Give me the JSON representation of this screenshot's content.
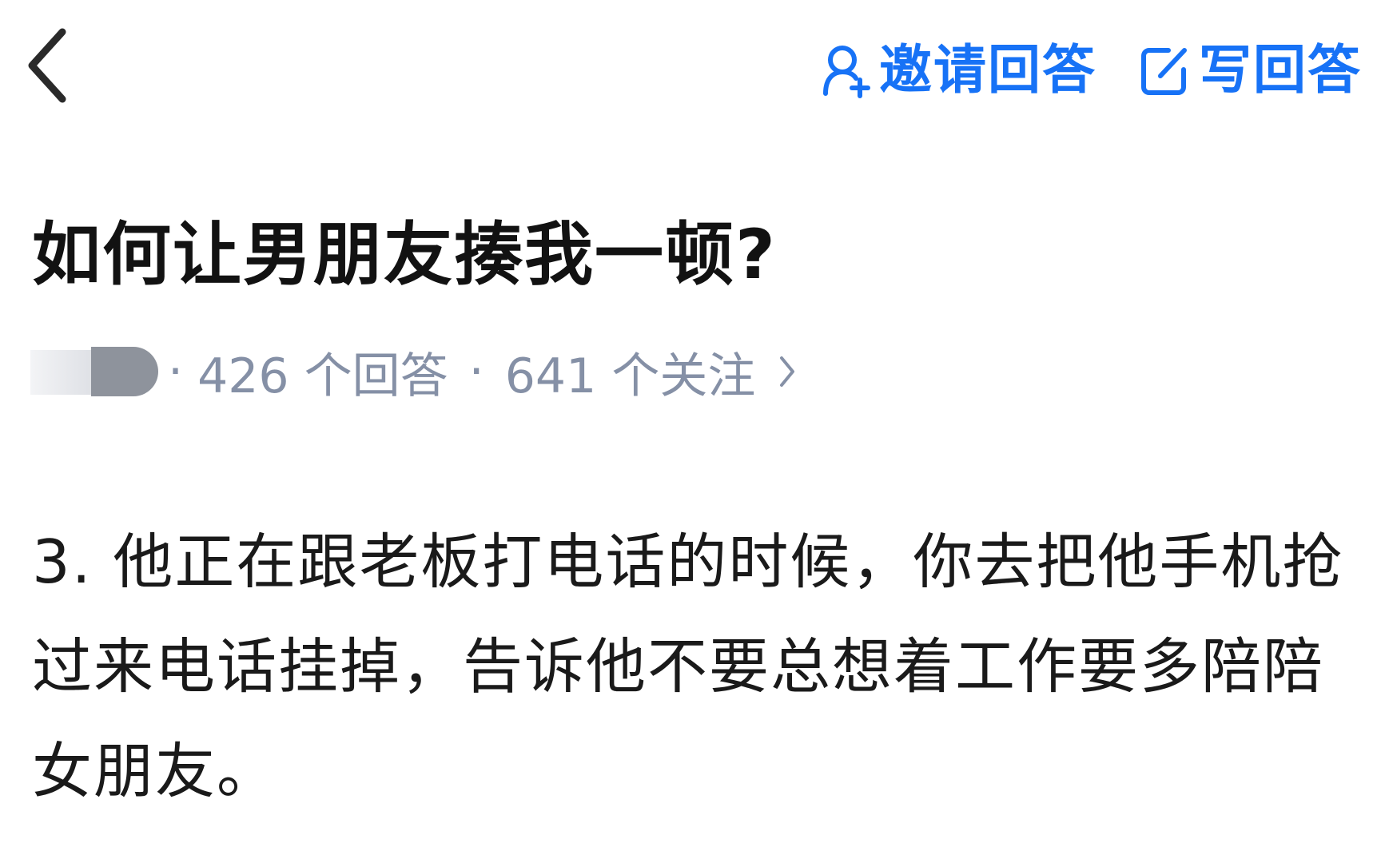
{
  "header": {
    "back_icon": "chevron-left-icon",
    "invite": {
      "icon": "add-user-icon",
      "label": "邀请回答"
    },
    "write": {
      "icon": "edit-icon",
      "label": "写回答"
    },
    "accent_color": "#1772f6"
  },
  "question": {
    "title": "如何让男朋友揍我一顿?"
  },
  "meta": {
    "answers": "426 个回答",
    "separator": "·",
    "followers": "641 个关注",
    "chevron_icon": "chevron-right-icon",
    "text_color": "#8590a6"
  },
  "answer": {
    "lines": [
      "3. 他正在跟老板打电话的时候，你去把他手机抢",
      "过来电话挂掉，告诉他不要总想着工作要多陪陪",
      "女朋友。"
    ]
  }
}
